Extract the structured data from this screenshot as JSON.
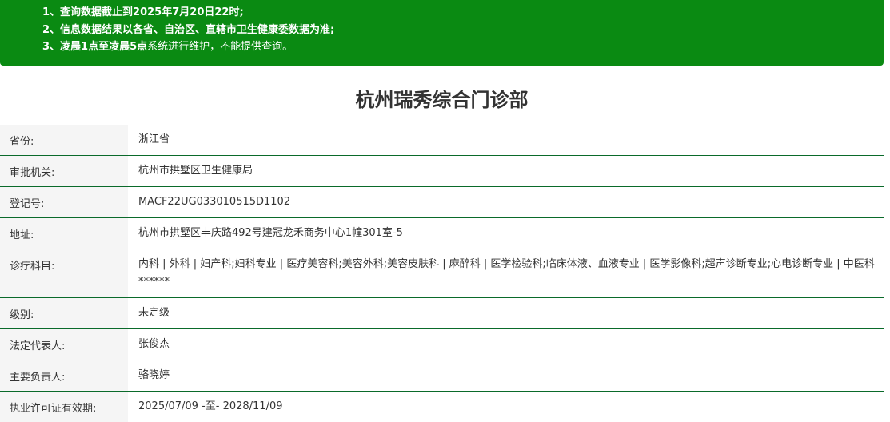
{
  "notice": {
    "line1": {
      "num": "1、",
      "text": "查询数据截止到2025年7月20日22时;"
    },
    "line2": {
      "num": "2、",
      "text": "信息数据结果以各省、自治区、直辖市卫生健康委数据为准;"
    },
    "line3": {
      "num": "3、",
      "bold": "凌晨1点至凌晨5点",
      "text": "系统进行维护，不能提供查询。"
    }
  },
  "title": "杭州瑞秀综合门诊部",
  "rows": [
    {
      "label": "省份:",
      "value": "浙江省"
    },
    {
      "label": "审批机关:",
      "value": "杭州市拱墅区卫生健康局"
    },
    {
      "label": "登记号:",
      "value": "MACF22UG033010515D1102"
    },
    {
      "label": "地址:",
      "value": "杭州市拱墅区丰庆路492号建冠龙禾商务中心1幢301室-5"
    },
    {
      "label": "诊疗科目:",
      "value": "内科 | 外科 | 妇产科;妇科专业 | 医疗美容科;美容外科;美容皮肤科 | 麻醉科 | 医学检验科;临床体液、血液专业 | 医学影像科;超声诊断专业;心电诊断专业 | 中医科******"
    },
    {
      "label": "级别:",
      "value": "未定级"
    },
    {
      "label": "法定代表人:",
      "value": "张俊杰"
    },
    {
      "label": "主要负责人:",
      "value": "骆晓婷"
    },
    {
      "label": "执业许可证有效期:",
      "value": "2025/07/09 -至- 2028/11/09"
    }
  ]
}
